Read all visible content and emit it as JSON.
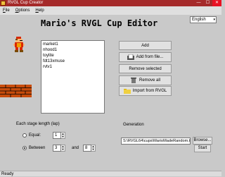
{
  "window": {
    "title": "RVGL Cup Creator",
    "minimize": "—",
    "maximize": "☐",
    "close": "✕"
  },
  "menu": {
    "file": "F",
    "file_rest": "ile",
    "options": "O",
    "options_rest": "ptions",
    "help": "H",
    "help_rest": "elp"
  },
  "header": {
    "title": "Mario's RVGL Cup Editor"
  },
  "language": {
    "selected": "English",
    "caret": "▾"
  },
  "tracks": [
    "market1",
    "nhood1",
    "toylite",
    "fdt13xmuse",
    "rvtv1"
  ],
  "buttons": {
    "add": "Add",
    "add_from_file": "Add from file...",
    "remove_selected": "Remove selected",
    "remove_all": "Remove all",
    "import": "Import from RVGL",
    "browse": "Browse...",
    "start": "Start"
  },
  "stage": {
    "heading": "Each stage length (lap)",
    "equal_label": "Equal:",
    "equal_value": "1",
    "between_label": "Between",
    "between_min": "3",
    "and_label": "and",
    "between_max": "8",
    "selected": "between"
  },
  "generation": {
    "heading": "Generation",
    "path": "S:\\RVGL64\\cups\\MarioMadeRandom.tx"
  },
  "status": {
    "text": "Ready"
  },
  "colors": {
    "titlebar": "#a52a2a",
    "close": "#e81123"
  },
  "icons": {
    "app": "app-icon",
    "add_file": "folder-doc-icon",
    "remove_all": "trash-icon",
    "import": "folder-icon"
  }
}
